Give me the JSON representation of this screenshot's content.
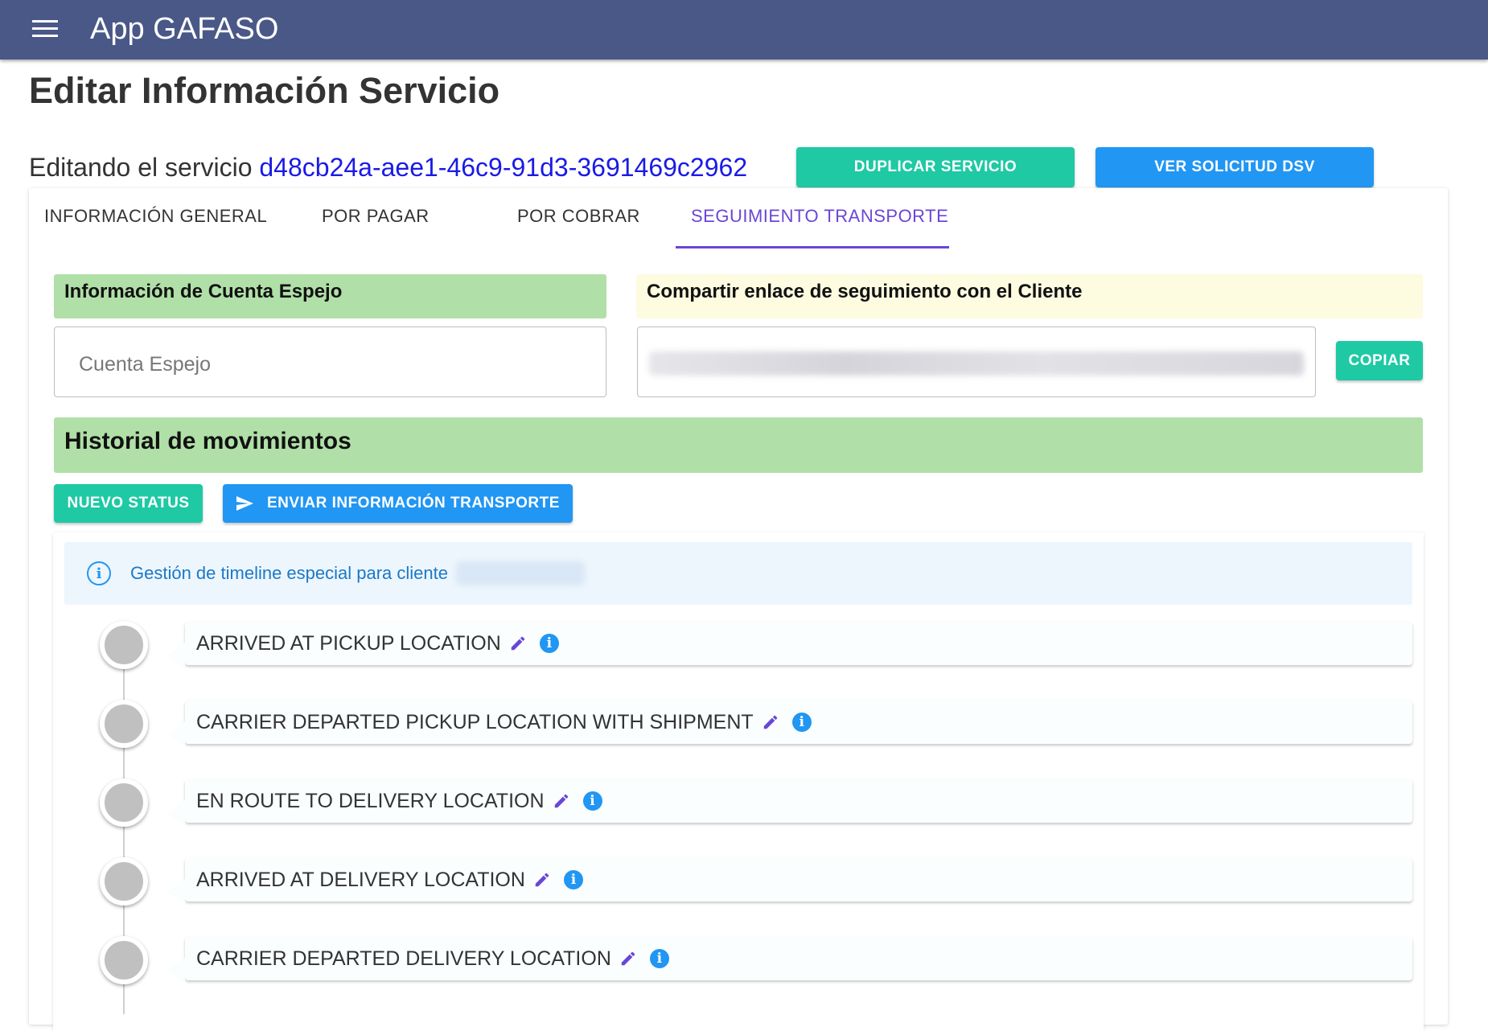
{
  "appbar": {
    "title": "App GAFASO",
    "menu_icon": "menu-icon"
  },
  "page": {
    "title": "Editar Información Servicio",
    "editing_prefix": "Editando el servicio",
    "service_id": "d48cb24a-aee1-46c9-91d3-3691469c2962"
  },
  "actions": {
    "duplicate_label": "DUPLICAR SERVICIO",
    "view_dsv_label": "VER SOLICITUD DSV"
  },
  "tabs": [
    {
      "label": "INFORMACIÓN GENERAL",
      "active": false
    },
    {
      "label": "POR PAGAR",
      "active": false
    },
    {
      "label": "POR COBRAR",
      "active": false
    },
    {
      "label": "SEGUIMIENTO TRANSPORTE",
      "active": true
    }
  ],
  "mirror_account": {
    "heading": "Información de Cuenta Espejo",
    "placeholder": "Cuenta Espejo",
    "value": ""
  },
  "share_link": {
    "heading": "Compartir enlace de seguimiento con el Cliente",
    "copy_label": "COPIAR"
  },
  "history": {
    "heading": "Historial de movimientos",
    "new_status_label": "NUEVO STATUS",
    "send_info_label": "ENVIAR INFORMACIÓN TRANSPORTE",
    "send_icon": "send-icon",
    "alert_text": "Gestión de timeline especial para cliente",
    "alert_icon": "info-outline-icon"
  },
  "timeline": [
    {
      "label": "ARRIVED AT PICKUP LOCATION"
    },
    {
      "label": "CARRIER DEPARTED PICKUP LOCATION WITH SHIPMENT"
    },
    {
      "label": "EN ROUTE TO DELIVERY LOCATION"
    },
    {
      "label": "ARRIVED AT DELIVERY LOCATION"
    },
    {
      "label": "CARRIER DEPARTED DELIVERY LOCATION"
    }
  ],
  "colors": {
    "appbar": "#4a5888",
    "accent_purple": "#6a46d6",
    "teal_button": "#1ec9a4",
    "blue_button": "#2196f3",
    "section_green": "#b0e0a8",
    "section_yellow": "#fdfbe0",
    "service_id_blue": "#1a1ae6"
  }
}
